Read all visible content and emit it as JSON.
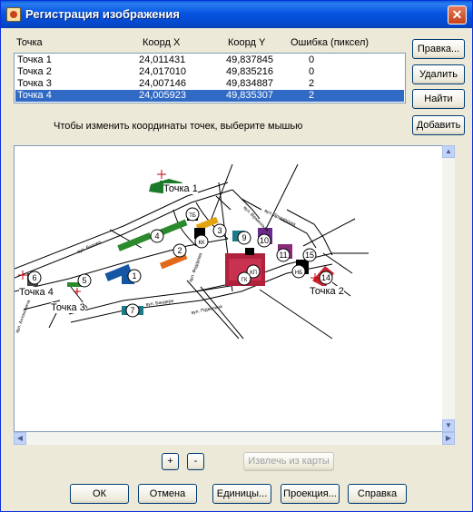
{
  "window": {
    "title": "Регистрация изображения",
    "close_glyph": "✕"
  },
  "table": {
    "headers": [
      "Точка",
      "Коорд X",
      "Коорд Y",
      "Ошибка (пиксел)"
    ],
    "rows": [
      [
        "Точка 1",
        "24,011431",
        "49,837845",
        "0"
      ],
      [
        "Точка 2",
        "24,017010",
        "49,835216",
        "0"
      ],
      [
        "Точка 3",
        "24,007146",
        "49,834887",
        "2"
      ],
      [
        "Точка 4",
        "24,005923",
        "49,835307",
        "2"
      ]
    ],
    "selected_row": 3
  },
  "side_buttons": {
    "edit": "Правка...",
    "delete": "Удалить",
    "find": "Найти",
    "add": "Добавить"
  },
  "hint": "Чтобы изменить координаты точек, выберите мышью",
  "map": {
    "point_labels": {
      "p1": "Точка 1",
      "p2": "Точка 2",
      "p3": "Точка 3",
      "p4": "Точка 4"
    },
    "street_labels": {
      "s1": "вул. Валова",
      "s2": "вул. Друкарська",
      "s3": "вул. Підвальна",
      "s4": "вул. Федорова",
      "s5": "вул. Вірменська",
      "s6": "вул. Бандери",
      "s7": "вул. Антоновича"
    },
    "markers": [
      "1",
      "2",
      "3",
      "4",
      "5",
      "6",
      "7",
      "9",
      "10",
      "11",
      "15",
      "14"
    ],
    "tags": [
      "ТБ",
      "КК",
      "КП",
      "ГК",
      "НБ"
    ]
  },
  "zoom": {
    "plus": "+",
    "minus": "-",
    "extract": "Извлечь из карты"
  },
  "footer": {
    "ok": "ОК",
    "cancel": "Отмена",
    "units": "Единицы...",
    "projection": "Проекция...",
    "help": "Справка"
  }
}
